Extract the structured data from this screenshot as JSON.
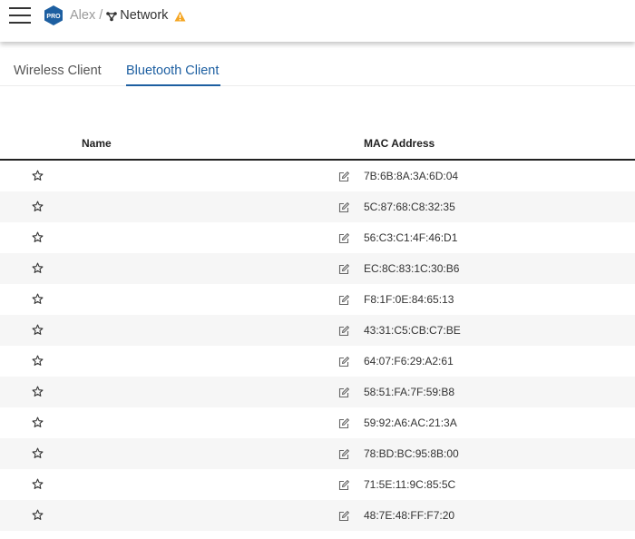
{
  "header": {
    "badge_label": "PRO",
    "breadcrumb_parent": "Alex",
    "breadcrumb_separator": "/",
    "breadcrumb_current": "Network",
    "icons": [
      "menu-icon",
      "pro-badge-icon",
      "network-topology-icon",
      "warning-icon"
    ],
    "warning_color": "#f5a623",
    "badge_color": "#1d5fa1"
  },
  "tabs": [
    {
      "label": "Wireless Client",
      "active": false
    },
    {
      "label": "Bluetooth Client",
      "active": true
    }
  ],
  "table": {
    "columns": {
      "name": "Name",
      "mac": "MAC Address"
    },
    "rows": [
      {
        "name": "",
        "mac": "7B:6B:8A:3A:6D:04"
      },
      {
        "name": "",
        "mac": "5C:87:68:C8:32:35"
      },
      {
        "name": "",
        "mac": "56:C3:C1:4F:46:D1"
      },
      {
        "name": "",
        "mac": "EC:8C:83:1C:30:B6"
      },
      {
        "name": "",
        "mac": "F8:1F:0E:84:65:13"
      },
      {
        "name": "",
        "mac": "43:31:C5:CB:C7:BE"
      },
      {
        "name": "",
        "mac": "64:07:F6:29:A2:61"
      },
      {
        "name": "",
        "mac": "58:51:FA:7F:59:B8"
      },
      {
        "name": "",
        "mac": "59:92:A6:AC:21:3A"
      },
      {
        "name": "",
        "mac": "78:BD:BC:95:8B:00"
      },
      {
        "name": "",
        "mac": "71:5E:11:9C:85:5C"
      },
      {
        "name": "",
        "mac": "48:7E:48:FF:F7:20"
      }
    ],
    "row_icons": [
      "star-icon",
      "edit-icon"
    ]
  },
  "accent_color": "#1d5fa1"
}
